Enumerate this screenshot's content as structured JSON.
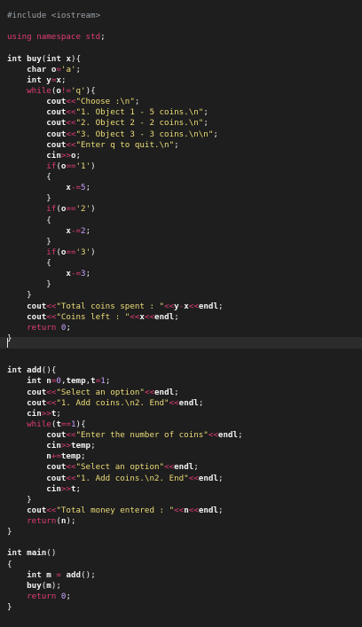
{
  "editor": {
    "lines": [
      "#include <iostream>",
      "",
      "using namespace std;",
      "",
      "int buy(int x){",
      "    char o='a';",
      "    int y=x;",
      "    while(o!='q'){",
      "        cout<<\"Choose :\\n\";",
      "        cout<<\"1. Object 1 - 5 coins.\\n\";",
      "        cout<<\"2. Object 2 - 2 coins.\\n\";",
      "        cout<<\"3. Object 3 - 3 coins.\\n\\n\";",
      "        cout<<\"Enter q to quit.\\n\";",
      "        cin>>o;",
      "        if(o=='1')",
      "        {",
      "            x-=5;",
      "        }",
      "        if(o=='2')",
      "        {",
      "            x-=2;",
      "        }",
      "        if(o=='3')",
      "        {",
      "            x-=3;",
      "        }",
      "    }",
      "    cout<<\"Total coins spent : \"<<y-x<<endl;",
      "    cout<<\"Coins left : \"<<x<<endl;",
      "    return 0;",
      "}",
      "",
      "",
      "int add(){",
      "    int n=0,temp,t=1;",
      "    cout<<\"Select an option\"<<endl;",
      "    cout<<\"1. Add coins.\\n2. End\"<<endl;",
      "    cin>>t;",
      "    while(t==1){",
      "        cout<<\"Enter the number of coins\"<<endl;",
      "        cin>>temp;",
      "        n+=temp;",
      "        cout<<\"Select an option\"<<endl;",
      "        cout<<\"1. Add coins.\\n2. End\"<<endl;",
      "        cin>>t;",
      "    }",
      "    cout<<\"Total money entered : \"<<n<<endl;",
      "    return(n);",
      "}",
      "",
      "int main()",
      "{",
      "    int m = add();",
      "    buy(m);",
      "    return 0;",
      "}"
    ]
  },
  "colors": {
    "background": "#1e1e1e",
    "current_line": "#2c2c2c",
    "preprocessor": "#9aa0a6",
    "keyword_control": "#e23c78",
    "string": "#ecdc77",
    "number": "#c8a3ff",
    "identifier": "#f2f2f2"
  }
}
